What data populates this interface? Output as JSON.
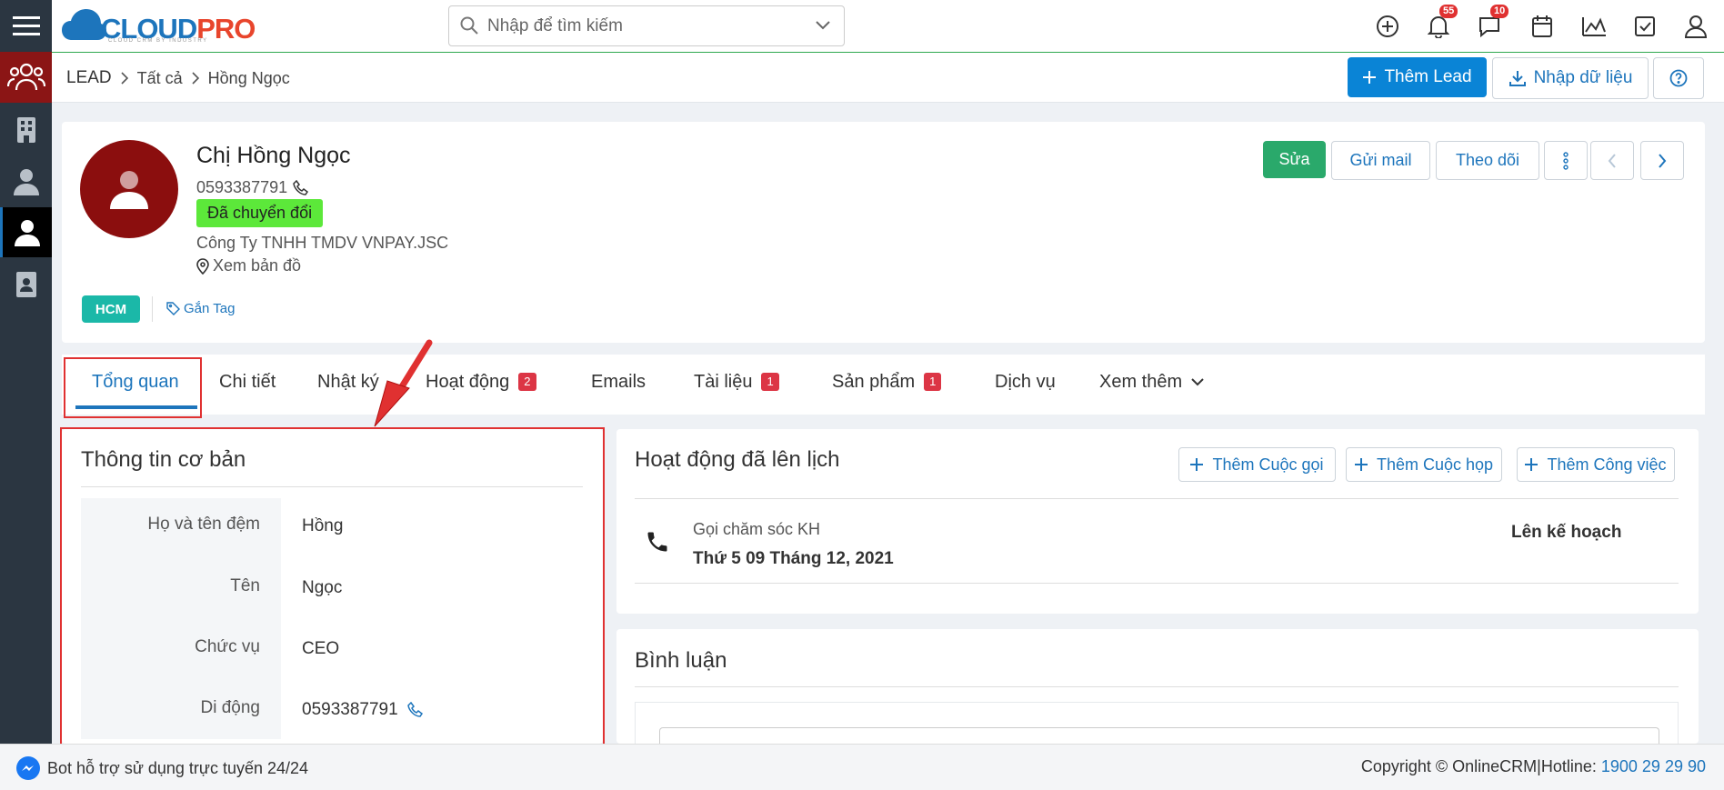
{
  "app": {
    "logo_main": "CLOUD",
    "logo_accent": "PRO",
    "logo_sub": "CLOUD CRM BY INDUSTRY"
  },
  "search": {
    "placeholder": "Nhập để tìm kiếm"
  },
  "topbar": {
    "notifications_count": "55",
    "messages_count": "10"
  },
  "sidebar": {
    "items": [
      {
        "name": "leads",
        "icon": "users-group-icon"
      },
      {
        "name": "organizations",
        "icon": "building-icon"
      },
      {
        "name": "contacts",
        "icon": "user-tie-icon"
      },
      {
        "name": "lead-person",
        "icon": "user-icon"
      },
      {
        "name": "documents",
        "icon": "contact-card-icon"
      }
    ]
  },
  "breadcrumb": {
    "module": "LEAD",
    "filter": "Tất cả",
    "record": "Hồng Ngọc"
  },
  "header_actions": {
    "add_label": "Thêm Lead",
    "import_label": "Nhập dữ liệu"
  },
  "record": {
    "name": "Chị Hồng Ngọc",
    "phone": "0593387791",
    "status": "Đã chuyển đổi",
    "company": "Công Ty TNHH TMDV VNPAY.JSC",
    "map_label": "Xem bản đồ",
    "tag": "HCM",
    "add_tag_label": "Gắn Tag"
  },
  "record_actions": {
    "edit": "Sửa",
    "send_mail": "Gửi mail",
    "follow": "Theo dõi"
  },
  "tabs": [
    {
      "label": "Tổng quan",
      "count": ""
    },
    {
      "label": "Chi tiết",
      "count": ""
    },
    {
      "label": "Nhật ký",
      "count": ""
    },
    {
      "label": "Hoạt động",
      "count": "2"
    },
    {
      "label": "Emails",
      "count": ""
    },
    {
      "label": "Tài liệu",
      "count": "1"
    },
    {
      "label": "Sản phẩm",
      "count": "1"
    },
    {
      "label": "Dịch vụ",
      "count": ""
    },
    {
      "label": "Xem thêm",
      "count": ""
    }
  ],
  "basic_info": {
    "title": "Thông tin cơ bản",
    "fields": [
      {
        "label": "Họ và tên đệm",
        "value": "Hồng"
      },
      {
        "label": "Tên",
        "value": "Ngọc"
      },
      {
        "label": "Chức vụ",
        "value": "CEO"
      },
      {
        "label": "Di động",
        "value": "0593387791"
      }
    ]
  },
  "scheduled": {
    "title": "Hoạt động đã lên lịch",
    "add_call": "Thêm Cuộc gọi",
    "add_meeting": "Thêm Cuộc họp",
    "add_task": "Thêm Công việc",
    "items": [
      {
        "subject": "Gọi chăm sóc KH",
        "date": "Thứ 5 09 Tháng 12, 2021",
        "status": "Lên kế hoạch"
      }
    ]
  },
  "comments": {
    "title": "Bình luận"
  },
  "footer": {
    "bot_text": "Bot hỗ trợ sử dụng trực tuyến 24/24",
    "copyright": "Copyright © OnlineCRM|Hotline: ",
    "hotline": "1900 29 29 90"
  },
  "colors": {
    "primary": "#0a84d6",
    "success": "#2aa96b",
    "sidebar": "#2b3641",
    "status_green": "#5ce83a",
    "tag": "#1bb8a8",
    "annotation_red": "#e03131",
    "avatar": "#8b0e0e"
  }
}
